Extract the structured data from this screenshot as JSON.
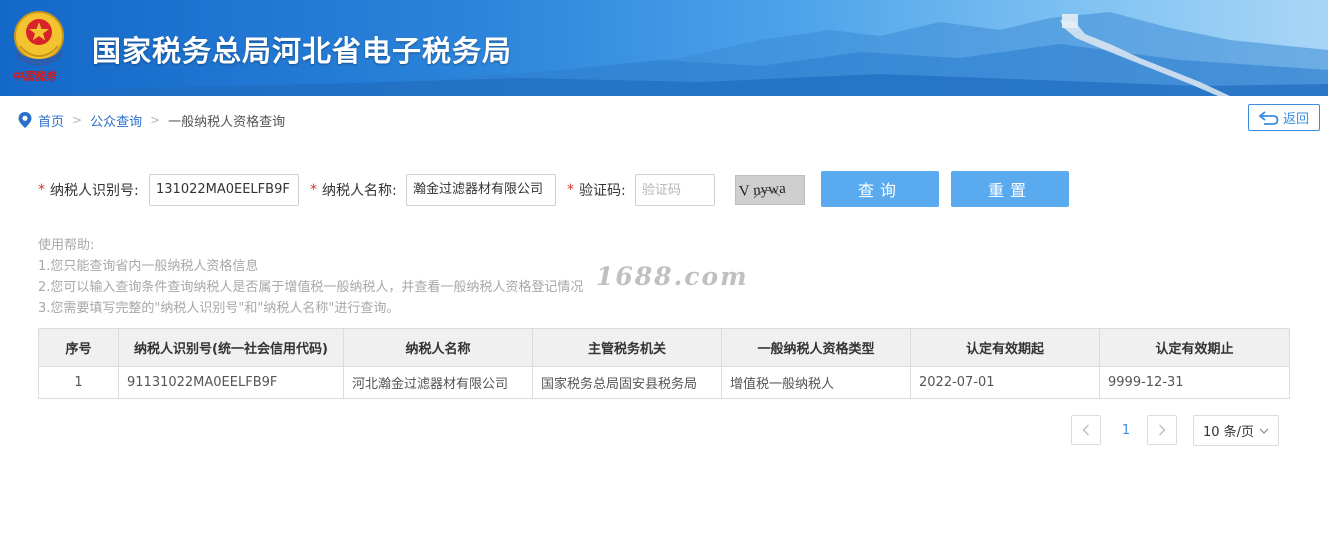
{
  "header": {
    "title": "国家税务总局河北省电子税务局",
    "seal_text": "中国税务"
  },
  "breadcrumb": {
    "items": [
      "首页",
      "公众查询"
    ],
    "current": "一般纳税人资格查询",
    "separator": ">"
  },
  "back_button": {
    "label": "返回"
  },
  "form": {
    "required_mark": "*",
    "taxpayer_id_label": "纳税人识别号:",
    "taxpayer_id_value": "131022MA0EELFB9F",
    "taxpayer_name_label": "纳税人名称:",
    "taxpayer_name_value": "瀚金过滤器材有限公司",
    "captcha_label": "验证码:",
    "captcha_placeholder": "验证码",
    "captcha_image_text": "V nywa",
    "query_button": "查询",
    "reset_button": "重置"
  },
  "help": {
    "title": "使用帮助:",
    "lines": [
      "1.您只能查询省内一般纳税人资格信息",
      "2.您可以输入查询条件查询纳税人是否属于增值税一般纳税人，并查看一般纳税人资格登记情况",
      "3.您需要填写完整的\"纳税人识别号\"和\"纳税人名称\"进行查询。"
    ]
  },
  "watermark": "1688.com",
  "table": {
    "columns": [
      "序号",
      "纳税人识别号(统一社会信用代码)",
      "纳税人名称",
      "主管税务机关",
      "一般纳税人资格类型",
      "认定有效期起",
      "认定有效期止"
    ],
    "rows": [
      [
        "1",
        "91131022MA0EELFB9F",
        "河北瀚金过滤器材有限公司",
        "国家税务总局固安县税务局",
        "增值税一般纳税人",
        "2022-07-01",
        "9999-12-31"
      ]
    ]
  },
  "pagination": {
    "current_page": "1",
    "page_size_label": "10 条/页"
  },
  "colors": {
    "accent": "#3a8ee0",
    "button": "#5aaaf0",
    "required": "#e0322c"
  }
}
